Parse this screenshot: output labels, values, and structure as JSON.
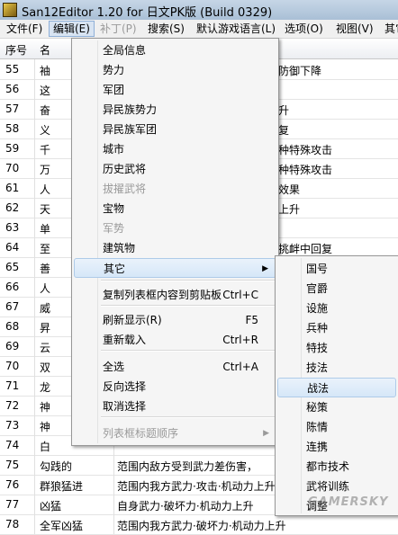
{
  "window": {
    "title": "San12Editor 1.20 for 日文PK版 (Build 0329)"
  },
  "menubar": [
    {
      "label": "文件(F)",
      "active": false,
      "disabled": false
    },
    {
      "label": "编辑(E)",
      "active": true,
      "disabled": false
    },
    {
      "label": "补丁(P)",
      "active": false,
      "disabled": true
    },
    {
      "label": "搜索(S)",
      "active": false,
      "disabled": false
    },
    {
      "label": "默认游戏语言(L)",
      "active": false,
      "disabled": false
    },
    {
      "label": "选项(O)",
      "active": false,
      "disabled": false
    },
    {
      "label": "视图(V)",
      "active": false,
      "disabled": false
    },
    {
      "label": "其它",
      "active": false,
      "disabled": false
    }
  ],
  "table": {
    "headers": [
      "序号",
      "名"
    ],
    "rows": [
      {
        "num": "55",
        "c1": "袖",
        "c2": "",
        "right": "防御下降"
      },
      {
        "num": "56",
        "c1": "这",
        "c2": "",
        "right": ""
      },
      {
        "num": "57",
        "c1": "奋",
        "c2": "",
        "right": "升"
      },
      {
        "num": "58",
        "c1": "义",
        "c2": "",
        "right": "复"
      },
      {
        "num": "59",
        "c1": "千",
        "c2": "",
        "right": "种特殊攻击"
      },
      {
        "num": "70",
        "c1": "万",
        "c2": "",
        "right": "种特殊攻击"
      },
      {
        "num": "61",
        "c1": "人",
        "c2": "",
        "right": "效果"
      },
      {
        "num": "62",
        "c1": "天",
        "c2": "",
        "right": "上升"
      },
      {
        "num": "63",
        "c1": "单",
        "c2": "",
        "right": ""
      },
      {
        "num": "64",
        "c1": "至",
        "c2": "",
        "right": "挑衅中回复"
      },
      {
        "num": "65",
        "c1": "善",
        "c2": "",
        "right": ""
      },
      {
        "num": "66",
        "c1": "人",
        "c2": "",
        "right": ""
      },
      {
        "num": "67",
        "c1": "威",
        "c2": "",
        "right": ""
      },
      {
        "num": "68",
        "c1": "昇",
        "c2": "",
        "right": ""
      },
      {
        "num": "69",
        "c1": "云",
        "c2": "",
        "right": ""
      },
      {
        "num": "70",
        "c1": "双",
        "c2": "",
        "right": ""
      },
      {
        "num": "71",
        "c1": "龙",
        "c2": "",
        "right": ""
      },
      {
        "num": "72",
        "c1": "神",
        "c2": "",
        "right": ""
      },
      {
        "num": "73",
        "c1": "神",
        "c2": "",
        "right": ""
      },
      {
        "num": "74",
        "c1": "白",
        "c2": "",
        "right": ""
      },
      {
        "num": "75",
        "c1": "勾践的",
        "c2": "范围内敌方受到武力差伤害，",
        "right": ""
      },
      {
        "num": "76",
        "c1": "群狼猛进",
        "c2": "范围内我方武力·攻击·机动力上升",
        "right": ""
      },
      {
        "num": "77",
        "c1": "凶猛",
        "c2": "自身武力·破坏力·机动力上升",
        "right": ""
      },
      {
        "num": "78",
        "c1": "全军凶猛",
        "c2": "范围内我方武力·破坏力·机动力上升",
        "right": ""
      }
    ]
  },
  "edit_menu": {
    "items": [
      {
        "label": "全局信息",
        "shortcut": "",
        "disabled": false,
        "submenu": false,
        "highlight": false
      },
      {
        "label": "势力",
        "shortcut": "",
        "disabled": false,
        "submenu": false,
        "highlight": false
      },
      {
        "label": "军团",
        "shortcut": "",
        "disabled": false,
        "submenu": false,
        "highlight": false
      },
      {
        "label": "异民族势力",
        "shortcut": "",
        "disabled": false,
        "submenu": false,
        "highlight": false
      },
      {
        "label": "异民族军团",
        "shortcut": "",
        "disabled": false,
        "submenu": false,
        "highlight": false
      },
      {
        "label": "城市",
        "shortcut": "",
        "disabled": false,
        "submenu": false,
        "highlight": false
      },
      {
        "label": "历史武将",
        "shortcut": "",
        "disabled": false,
        "submenu": false,
        "highlight": false
      },
      {
        "label": "拔擢武将",
        "shortcut": "",
        "disabled": true,
        "submenu": false,
        "highlight": false
      },
      {
        "label": "宝物",
        "shortcut": "",
        "disabled": false,
        "submenu": false,
        "highlight": false
      },
      {
        "label": "军势",
        "shortcut": "",
        "disabled": true,
        "submenu": false,
        "highlight": false
      },
      {
        "label": "建筑物",
        "shortcut": "",
        "disabled": false,
        "submenu": false,
        "highlight": false
      },
      {
        "label": "其它",
        "shortcut": "",
        "disabled": false,
        "submenu": true,
        "highlight": true
      },
      {
        "label": "复制列表框内容到剪贴板",
        "shortcut": "Ctrl+C",
        "disabled": false,
        "submenu": false,
        "highlight": false
      },
      {
        "label": "刷新显示(R)",
        "shortcut": "F5",
        "disabled": false,
        "submenu": false,
        "highlight": false
      },
      {
        "label": "重新载入",
        "shortcut": "Ctrl+R",
        "disabled": false,
        "submenu": false,
        "highlight": false
      },
      {
        "label": "全选",
        "shortcut": "Ctrl+A",
        "disabled": false,
        "submenu": false,
        "highlight": false
      },
      {
        "label": "反向选择",
        "shortcut": "",
        "disabled": false,
        "submenu": false,
        "highlight": false
      },
      {
        "label": "取消选择",
        "shortcut": "",
        "disabled": false,
        "submenu": false,
        "highlight": false
      },
      {
        "label": "列表框标题顺序",
        "shortcut": "",
        "disabled": true,
        "submenu": true,
        "highlight": false
      }
    ]
  },
  "sub_menu": {
    "items": [
      {
        "label": "国号",
        "highlight": false
      },
      {
        "label": "官爵",
        "highlight": false
      },
      {
        "label": "设施",
        "highlight": false
      },
      {
        "label": "兵种",
        "highlight": false
      },
      {
        "label": "特技",
        "highlight": false
      },
      {
        "label": "技法",
        "highlight": false
      },
      {
        "label": "战法",
        "highlight": true
      },
      {
        "label": "秘策",
        "highlight": false
      },
      {
        "label": "陈情",
        "highlight": false
      },
      {
        "label": "连携",
        "highlight": false
      },
      {
        "label": "都市技术",
        "highlight": false
      },
      {
        "label": "武将训练",
        "highlight": false
      },
      {
        "label": "调整",
        "highlight": false
      }
    ]
  },
  "watermark": "GAMERSKY"
}
